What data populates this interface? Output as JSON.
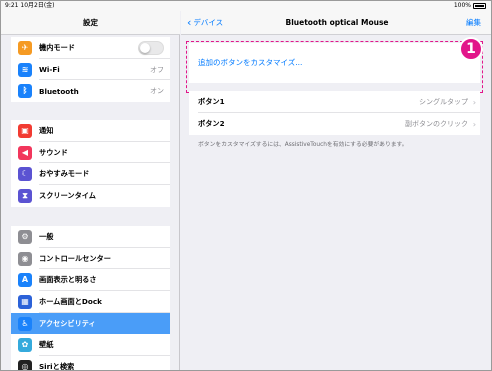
{
  "status": {
    "time_date": "9:21  10月2日(金)",
    "battery": "100%"
  },
  "sidebar": {
    "title": "設定",
    "groups": [
      [
        {
          "label": "機内モード",
          "icon": "airplane-icon",
          "color": "#f59a23",
          "glyph": "✈",
          "toggle": true
        },
        {
          "label": "Wi-Fi",
          "icon": "wifi-icon",
          "color": "#1a82fb",
          "glyph": "≋",
          "value": "オフ"
        },
        {
          "label": "Bluetooth",
          "icon": "bluetooth-icon",
          "color": "#1a82fb",
          "glyph": "ᛒ",
          "value": "オン"
        }
      ],
      [
        {
          "label": "通知",
          "icon": "notification-icon",
          "color": "#f23b32",
          "glyph": "▣"
        },
        {
          "label": "サウンド",
          "icon": "sound-icon",
          "color": "#f2365c",
          "glyph": "◀"
        },
        {
          "label": "おやすみモード",
          "icon": "moon-icon",
          "color": "#5b53d2",
          "glyph": "☾"
        },
        {
          "label": "スクリーンタイム",
          "icon": "hourglass-icon",
          "color": "#5b53d2",
          "glyph": "⧗"
        }
      ],
      [
        {
          "label": "一般",
          "icon": "gear-icon",
          "color": "#8e8e93",
          "glyph": "⚙"
        },
        {
          "label": "コントロールセンター",
          "icon": "control-center-icon",
          "color": "#8e8e93",
          "glyph": "◉"
        },
        {
          "label": "画面表示と明るさ",
          "icon": "display-icon",
          "color": "#1a82fb",
          "glyph": "A"
        },
        {
          "label": "ホーム画面とDock",
          "icon": "home-screen-icon",
          "color": "#2c62d8",
          "glyph": "▦"
        },
        {
          "label": "アクセシビリティ",
          "icon": "accessibility-icon",
          "color": "#1a82fb",
          "glyph": "♿",
          "selected": true
        },
        {
          "label": "壁紙",
          "icon": "wallpaper-icon",
          "color": "#35aadc",
          "glyph": "✿"
        },
        {
          "label": "Siriと検索",
          "icon": "siri-icon",
          "color": "#222222",
          "glyph": "◎"
        }
      ]
    ]
  },
  "detail": {
    "back_label": "デバイス",
    "title": "Bluetooth optical Mouse",
    "edit_label": "編集",
    "customize_label": "追加のボタンをカスタマイズ...",
    "badge": "1",
    "buttons": [
      {
        "label": "ボタン1",
        "value": "シングルタップ"
      },
      {
        "label": "ボタン2",
        "value": "副ボタンのクリック"
      }
    ],
    "footnote": "ボタンをカスタマイズするには、AssistiveTouchを有効にする必要があります。"
  },
  "colors": {
    "accent": "#007aff",
    "highlight": "#e2168a",
    "selected_row": "#4a9df8"
  }
}
